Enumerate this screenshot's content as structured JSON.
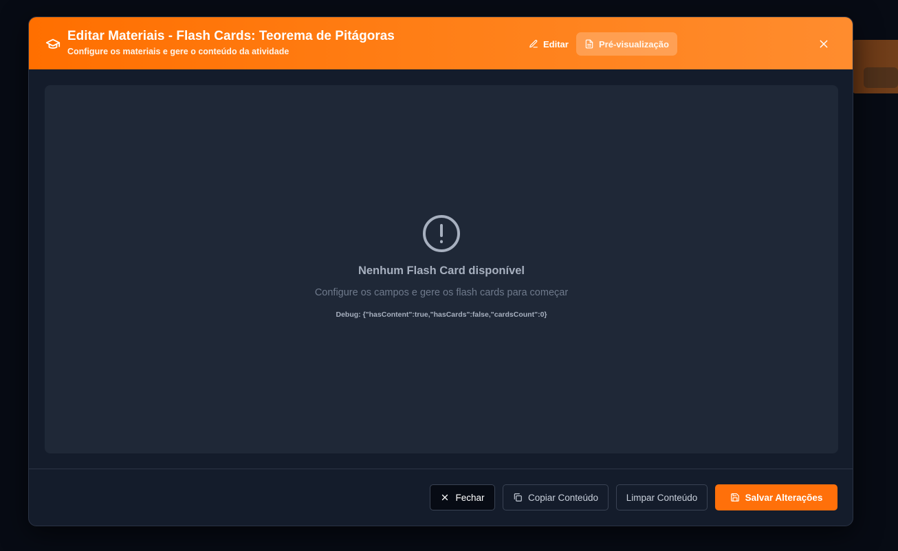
{
  "modal": {
    "title": "Editar Materiais - Flash Cards: Teorema de Pitágoras",
    "subtitle": "Configure os materiais e gere o conteúdo da atividade",
    "header_icon": "graduation-cap-icon",
    "tabs": [
      {
        "label": "Editar",
        "icon": "pencil-icon",
        "active": false
      },
      {
        "label": "Pré-visualização",
        "icon": "document-icon",
        "active": true
      }
    ],
    "close_icon": "close-icon"
  },
  "empty_state": {
    "icon": "alert-circle-icon",
    "title": "Nenhum Flash Card disponível",
    "message": "Configure os campos e gere os flash cards para começar",
    "debug": "Debug: {\"hasContent\":true,\"hasCards\":false,\"cardsCount\":0}"
  },
  "footer": {
    "close_label": "Fechar",
    "copy_label": "Copiar Conteúdo",
    "clear_label": "Limpar Conteúdo",
    "save_label": "Salvar Alterações"
  },
  "colors": {
    "accent": "#ff700a",
    "header_gradient_start": "#ff6f00",
    "header_gradient_end": "#ff8c2e",
    "modal_bg": "#141c2b",
    "content_bg": "#1f2837"
  }
}
